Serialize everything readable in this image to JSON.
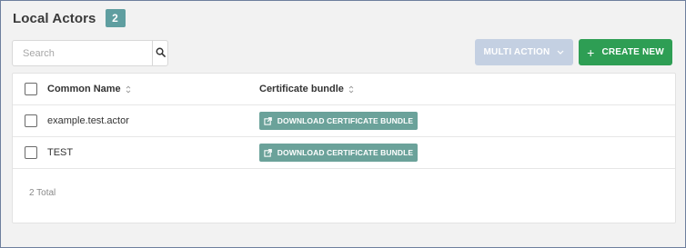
{
  "header": {
    "title": "Local Actors",
    "count_badge": "2"
  },
  "search": {
    "placeholder": "Search",
    "value": ""
  },
  "toolbar": {
    "multi_action_label": "MULTI ACTION",
    "create_new_label": "CREATE NEW"
  },
  "table": {
    "columns": [
      "Common Name",
      "Certificate bundle"
    ],
    "rows": [
      {
        "common_name": "example.test.actor",
        "cert_button": "DOWNLOAD CERTIFICATE BUNDLE"
      },
      {
        "common_name": "TEST",
        "cert_button": "DOWNLOAD CERTIFICATE BUNDLE"
      }
    ],
    "total": "2 Total"
  },
  "colors": {
    "badge": "#5f9ea0",
    "multi_action_disabled": "#c4d0e2",
    "create_new": "#2e9e54",
    "download_button": "#6ba29a"
  },
  "icons": {
    "search": "search-icon",
    "chevron": "chevron-down-icon",
    "plus": "plus-icon",
    "external": "external-link-icon",
    "sort": "sort-icon"
  }
}
